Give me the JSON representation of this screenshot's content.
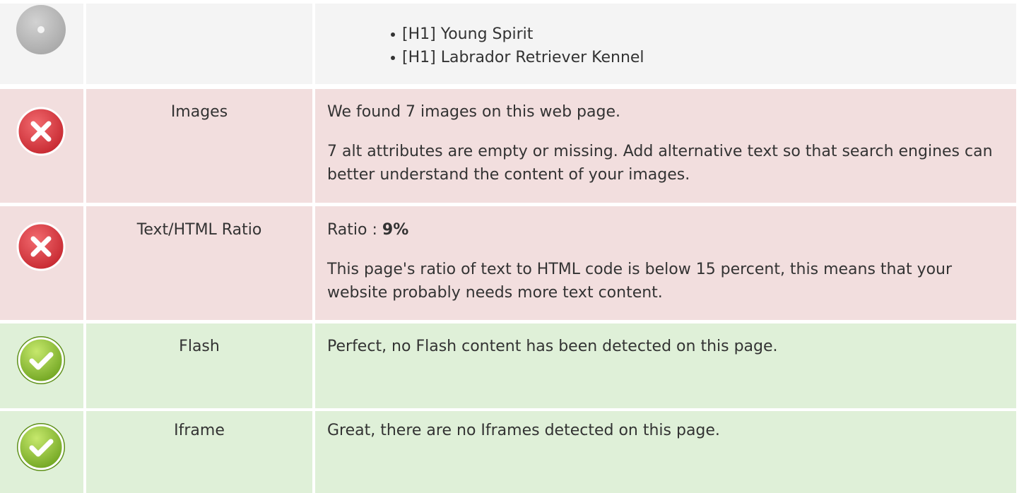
{
  "rows": [
    {
      "status": "neutral",
      "icon": "neutral-circle-icon",
      "label": "",
      "headings": [
        "[H1] Young Spirit",
        "[H1] Labrador Retriever Kennel"
      ]
    },
    {
      "status": "error",
      "icon": "error-x-icon",
      "label": "Images",
      "paragraphs": [
        "We found 7 images on this web page.",
        "7 alt attributes are empty or missing. Add alternative text so that search engines can better understand the content of your images."
      ]
    },
    {
      "status": "error",
      "icon": "error-x-icon",
      "label": "Text/HTML Ratio",
      "ratio_prefix": "Ratio : ",
      "ratio_value": "9%",
      "paragraphs": [
        "This page's ratio of text to HTML code is below 15 percent, this means that your website probably needs more text content."
      ]
    },
    {
      "status": "success",
      "icon": "success-check-icon",
      "label": "Flash",
      "paragraphs": [
        "Perfect, no Flash content has been detected on this page."
      ]
    },
    {
      "status": "success",
      "icon": "success-check-icon",
      "label": "Iframe",
      "paragraphs": [
        "Great, there are no Iframes detected on this page."
      ]
    }
  ],
  "colors": {
    "neutral_bg": "#f4f4f4",
    "error_bg": "#f2dede",
    "success_bg": "#dff0d8",
    "error_icon": "#d9363e",
    "success_icon": "#8bc34a",
    "neutral_icon": "#b3b3b3"
  }
}
